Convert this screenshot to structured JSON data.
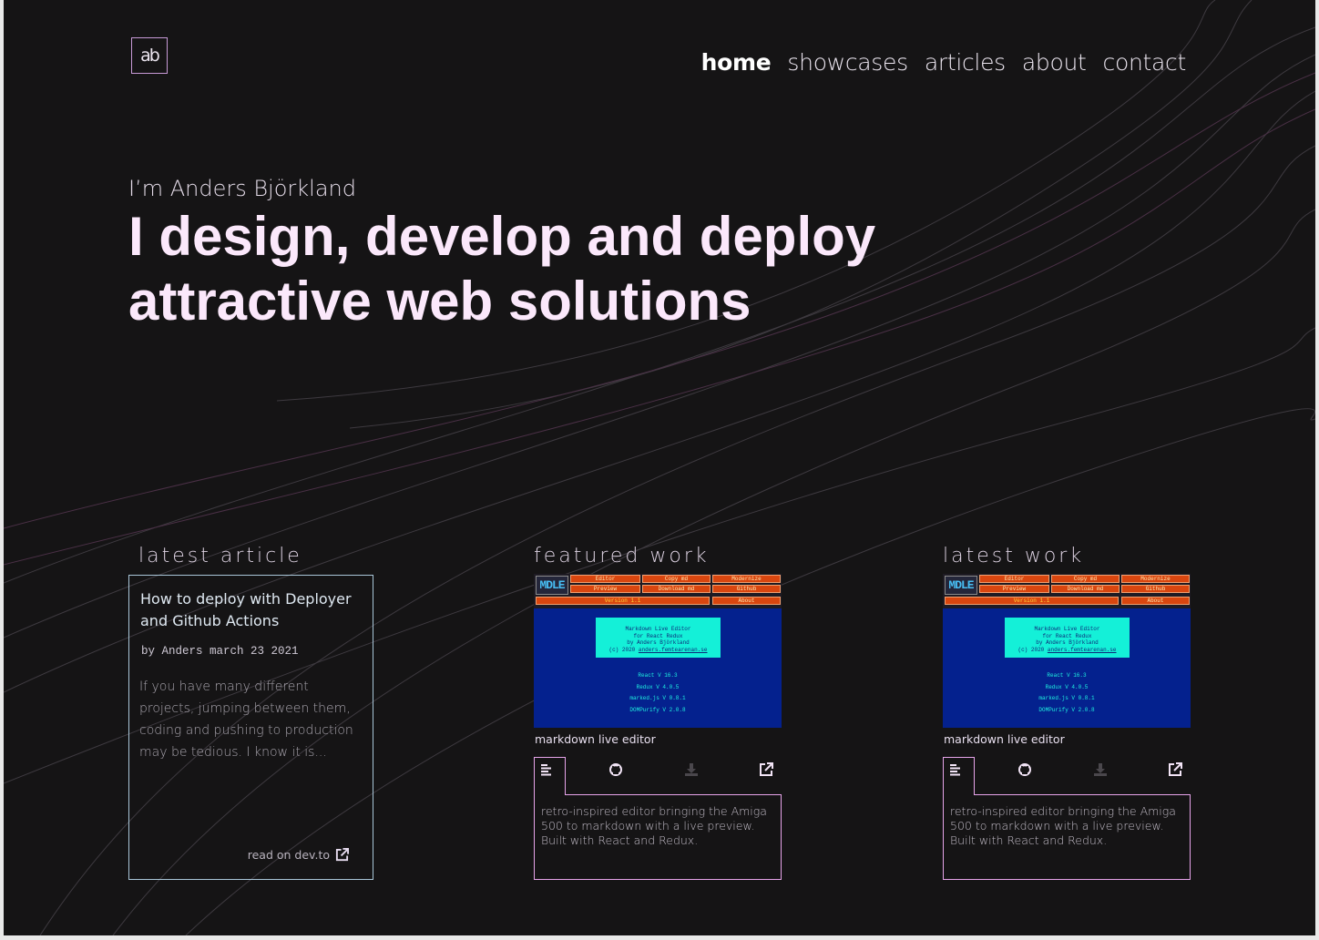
{
  "header": {
    "logo_text": "ab",
    "nav": [
      {
        "label": "home",
        "active": true
      },
      {
        "label": "showcases",
        "active": false
      },
      {
        "label": "articles",
        "active": false
      },
      {
        "label": "about",
        "active": false
      },
      {
        "label": "contact",
        "active": false
      }
    ]
  },
  "hero": {
    "intro": "I’m Anders Björkland",
    "headline_line1": "I design, develop and deploy",
    "headline_line2": "attractive web solutions"
  },
  "latest_article": {
    "section_title": "latest article",
    "title": "How to deploy with Deployer and Github Actions",
    "meta": "by Anders march 23 2021",
    "excerpt": "If you have many different projects, jumping between them, coding and pushing to production may be tedious. I know it is...",
    "link_label": "read on dev.to"
  },
  "thumbnail": {
    "logo": "MDLE",
    "buttons": [
      "Editor",
      "Copy md",
      "Modernize",
      "Preview",
      "Download md",
      "Github",
      "About"
    ],
    "version": "Version 1.1",
    "info_lines": [
      "Markdown Live Editor",
      "for React Redux",
      "by Anders Björkland",
      "(c) 2020"
    ],
    "info_link": "anders.femtearenan.se",
    "versions": [
      "React V 16.3",
      "Redux V 4.0.5",
      "marked.js V 0.8.1",
      "DOMPurify V 2.0.8"
    ]
  },
  "featured_work": {
    "section_title": "featured work",
    "caption": "markdown live editor",
    "description": "retro-inspired editor bringing the Amiga 500 to markdown with a live preview. Built with React and Redux."
  },
  "latest_work": {
    "section_title": "latest work",
    "caption": "markdown live editor",
    "description": "retro-inspired editor bringing the Amiga 500 to markdown with a live preview. Built with React and Redux."
  },
  "icons": {
    "panel": [
      "text-align-left-icon",
      "github-icon",
      "download-icon",
      "external-link-icon"
    ]
  },
  "colors": {
    "background": "#151415",
    "headline": "#fbe8fb",
    "accent_pink": "#e7a4ea",
    "article_border": "#a9c6d8",
    "thumb_blue": "#04218e",
    "thumb_orange": "#d9460f",
    "thumb_cyan": "#14f0d8"
  }
}
